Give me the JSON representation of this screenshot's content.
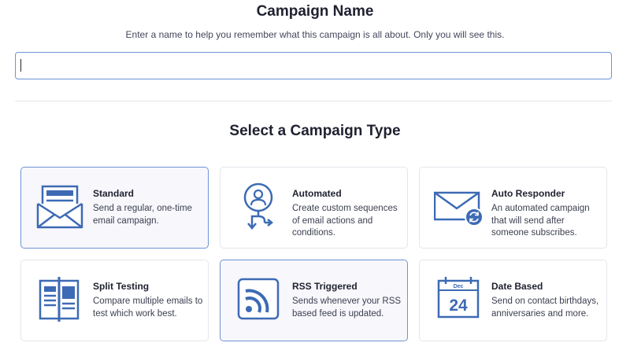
{
  "header": {
    "title": "Campaign Name",
    "subtitle": "Enter a name to help you remember what this campaign is all about. Only you will see this."
  },
  "name_input": {
    "value": "",
    "placeholder": ""
  },
  "section_title": "Select a Campaign Type",
  "colors": {
    "accent": "#3d6ab4",
    "selected_border": "#6f93d6",
    "selected_bg": "#f7f7fc"
  },
  "campaign_types": [
    {
      "title": "Standard",
      "description": "Send a regular, one-time email campaign.",
      "icon": "envelope-newsletter-icon",
      "selected": true
    },
    {
      "title": "Automated",
      "description": "Create custom sequences of email actions and conditions.",
      "icon": "user-flow-icon",
      "selected": false
    },
    {
      "title": "Auto Responder",
      "description": "An automated campaign that will send after someone subscribes.",
      "icon": "envelope-refresh-icon",
      "selected": false
    },
    {
      "title": "Split Testing",
      "description": "Compare multiple emails to test which work best.",
      "icon": "split-document-icon",
      "selected": false
    },
    {
      "title": "RSS Triggered",
      "description": "Sends whenever your RSS based feed is updated.",
      "icon": "rss-icon",
      "selected": true
    },
    {
      "title": "Date Based",
      "description": "Send on contact birthdays, anniversaries and more.",
      "icon": "calendar-icon",
      "selected": false,
      "icon_text": {
        "month": "Dec",
        "day": "24"
      }
    }
  ]
}
